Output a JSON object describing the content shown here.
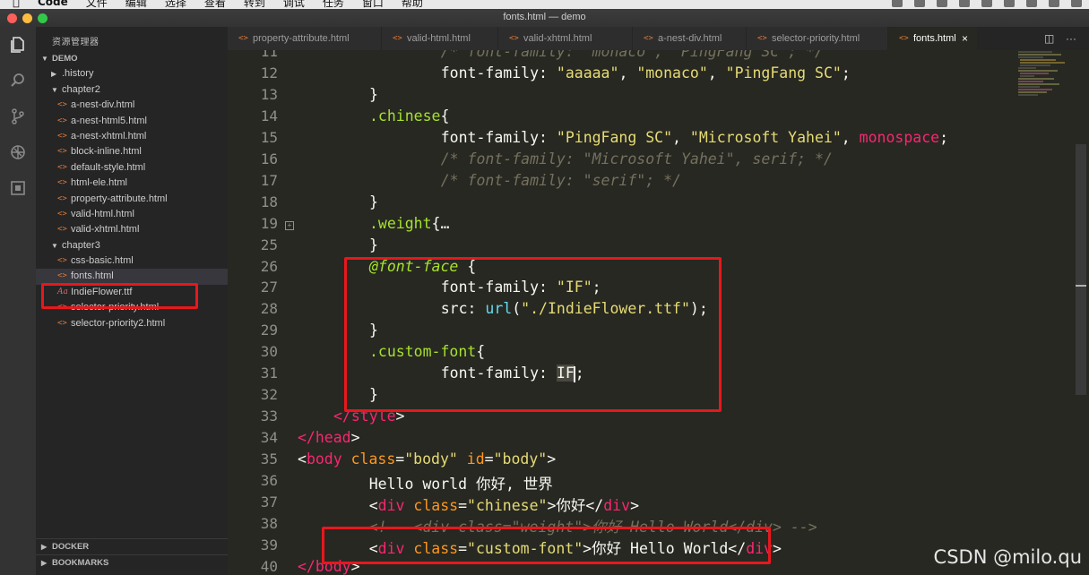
{
  "menubar": {
    "app_name": "Code",
    "items": [
      "文件",
      "编辑",
      "选择",
      "查看",
      "转到",
      "调试",
      "任务",
      "窗口",
      "帮助"
    ]
  },
  "window": {
    "title": "fonts.html — demo"
  },
  "activity_bar": [
    "files-icon",
    "search-icon",
    "source-control-icon",
    "debug-icon",
    "extensions-icon"
  ],
  "sidebar": {
    "title": "资源管理器",
    "section": "DEMO",
    "tree": [
      {
        "label": ".history",
        "type": "folder-collapsed"
      },
      {
        "label": "chapter2",
        "type": "folder-expanded"
      },
      {
        "label": "a-nest-div.html",
        "type": "html"
      },
      {
        "label": "a-nest-html5.html",
        "type": "html"
      },
      {
        "label": "a-nest-xhtml.html",
        "type": "html"
      },
      {
        "label": "block-inline.html",
        "type": "html"
      },
      {
        "label": "default-style.html",
        "type": "html"
      },
      {
        "label": "html-ele.html",
        "type": "html"
      },
      {
        "label": "property-attribute.html",
        "type": "html"
      },
      {
        "label": "valid-html.html",
        "type": "html"
      },
      {
        "label": "valid-xhtml.html",
        "type": "html"
      },
      {
        "label": "chapter3",
        "type": "folder-expanded"
      },
      {
        "label": "css-basic.html",
        "type": "html"
      },
      {
        "label": "fonts.html",
        "type": "html",
        "active": true
      },
      {
        "label": "IndieFlower.ttf",
        "type": "font"
      },
      {
        "label": "selector-priority.html",
        "type": "html"
      },
      {
        "label": "selector-priority2.html",
        "type": "html"
      }
    ],
    "bottom_sections": [
      "DOCKER",
      "BOOKMARKS"
    ]
  },
  "tabs": [
    {
      "label": "property-attribute.html"
    },
    {
      "label": "valid-html.html"
    },
    {
      "label": "valid-xhtml.html"
    },
    {
      "label": "a-nest-div.html"
    },
    {
      "label": "selector-priority.html"
    },
    {
      "label": "fonts.html",
      "active": true
    }
  ],
  "tab_close": "×",
  "editor": {
    "lines": [
      {
        "n": "11",
        "tokens": [
          [
            "c",
            "    /* font-family: \"monaco\", \"PingFang SC\"; */"
          ]
        ]
      },
      {
        "n": "12",
        "tokens": [
          [
            "w",
            "    font-family: "
          ],
          [
            "s",
            "\"aaaaa\""
          ],
          [
            "w",
            ", "
          ],
          [
            "s",
            "\"monaco\""
          ],
          [
            "w",
            ", "
          ],
          [
            "s",
            "\"PingFang SC\""
          ],
          [
            "w",
            ";"
          ]
        ]
      },
      {
        "n": "13",
        "tokens": [
          [
            "w",
            "}"
          ]
        ]
      },
      {
        "n": "14",
        "tokens": [
          [
            "cls",
            ".chinese"
          ],
          [
            "w",
            "{"
          ]
        ]
      },
      {
        "n": "15",
        "tokens": [
          [
            "w",
            "    font-family: "
          ],
          [
            "s",
            "\"PingFang SC\""
          ],
          [
            "w",
            ", "
          ],
          [
            "s",
            "\"Microsoft Yahei\""
          ],
          [
            "w",
            ", "
          ],
          [
            "p",
            "monospace"
          ],
          [
            "w",
            ";"
          ]
        ]
      },
      {
        "n": "16",
        "tokens": [
          [
            "c",
            "    /* font-family: \"Microsoft Yahei\", serif; */"
          ]
        ]
      },
      {
        "n": "17",
        "tokens": [
          [
            "c",
            "    /* font-family: \"serif\"; */"
          ]
        ]
      },
      {
        "n": "18",
        "tokens": [
          [
            "w",
            "}"
          ]
        ]
      },
      {
        "n": "19",
        "tokens": [
          [
            "cls",
            ".weight"
          ],
          [
            "w",
            "{…"
          ]
        ],
        "folded": true
      },
      {
        "n": "25",
        "tokens": [
          [
            "w",
            "}"
          ]
        ]
      },
      {
        "n": "26",
        "tokens": [
          [
            "at",
            "@font-face"
          ],
          [
            "w",
            " {"
          ]
        ]
      },
      {
        "n": "27",
        "tokens": [
          [
            "w",
            "    font-family: "
          ],
          [
            "s",
            "\"IF\""
          ],
          [
            "w",
            ";"
          ]
        ]
      },
      {
        "n": "28",
        "tokens": [
          [
            "w",
            "    src: "
          ],
          [
            "fn",
            "url"
          ],
          [
            "w",
            "("
          ],
          [
            "s",
            "\"./IndieFlower.ttf\""
          ],
          [
            "w",
            ");"
          ]
        ]
      },
      {
        "n": "29",
        "tokens": [
          [
            "w",
            "}"
          ]
        ]
      },
      {
        "n": "30",
        "tokens": [
          [
            "cls",
            ".custom-font"
          ],
          [
            "w",
            "{"
          ]
        ]
      },
      {
        "n": "31",
        "tokens": [
          [
            "w",
            "    font-family: "
          ],
          [
            "sel",
            "IF"
          ],
          [
            "cursor",
            ""
          ],
          [
            "w",
            ";"
          ]
        ]
      },
      {
        "n": "32",
        "tokens": [
          [
            "w",
            "}"
          ]
        ]
      },
      {
        "n": "33",
        "tokens": [
          [
            "tag",
            "</style"
          ],
          [
            "w",
            ">"
          ]
        ]
      },
      {
        "n": "34",
        "tokens": [
          [
            "tag",
            "</head"
          ],
          [
            "w",
            ">"
          ]
        ]
      },
      {
        "n": "35",
        "tokens": [
          [
            "w",
            "<"
          ],
          [
            "tag",
            "body"
          ],
          [
            "w",
            " "
          ],
          [
            "o",
            "class"
          ],
          [
            "w",
            "="
          ],
          [
            "s",
            "\"body\""
          ],
          [
            "w",
            " "
          ],
          [
            "o",
            "id"
          ],
          [
            "w",
            "="
          ],
          [
            "s",
            "\"body\""
          ],
          [
            "w",
            ">"
          ]
        ]
      },
      {
        "n": "36",
        "tokens": [
          [
            "w",
            "    Hello world 你好, 世界"
          ]
        ]
      },
      {
        "n": "37",
        "tokens": [
          [
            "w",
            "    <"
          ],
          [
            "tag",
            "div"
          ],
          [
            "w",
            " "
          ],
          [
            "o",
            "class"
          ],
          [
            "w",
            "="
          ],
          [
            "s",
            "\"chinese\""
          ],
          [
            "w",
            ">你好</"
          ],
          [
            "tag",
            "div"
          ],
          [
            "w",
            ">"
          ]
        ]
      },
      {
        "n": "38",
        "tokens": [
          [
            "c",
            "    <!-- <div class=\"weight\">你好 Hello World</div> -->"
          ]
        ]
      },
      {
        "n": "39",
        "tokens": [
          [
            "w",
            "    <"
          ],
          [
            "tag",
            "div"
          ],
          [
            "w",
            " "
          ],
          [
            "o",
            "class"
          ],
          [
            "w",
            "="
          ],
          [
            "s",
            "\"custom-font\""
          ],
          [
            "w",
            ">你好 Hello World</"
          ],
          [
            "tag",
            "div"
          ],
          [
            "w",
            ">"
          ]
        ]
      },
      {
        "n": "40",
        "tokens": [
          [
            "tag",
            "</body"
          ],
          [
            "w",
            ">"
          ]
        ]
      }
    ],
    "indents": [
      3,
      3,
      2,
      2,
      3,
      3,
      3,
      2,
      2,
      2,
      2,
      3,
      3,
      2,
      2,
      3,
      2,
      1,
      0,
      0,
      1,
      1,
      1,
      1,
      0
    ]
  },
  "watermark": "CSDN @milo.qu",
  "colors": {
    "highlight_box": "#e8171c",
    "editor_bg": "#272822",
    "sidebar_bg": "#252526",
    "activity_bg": "#333333"
  }
}
